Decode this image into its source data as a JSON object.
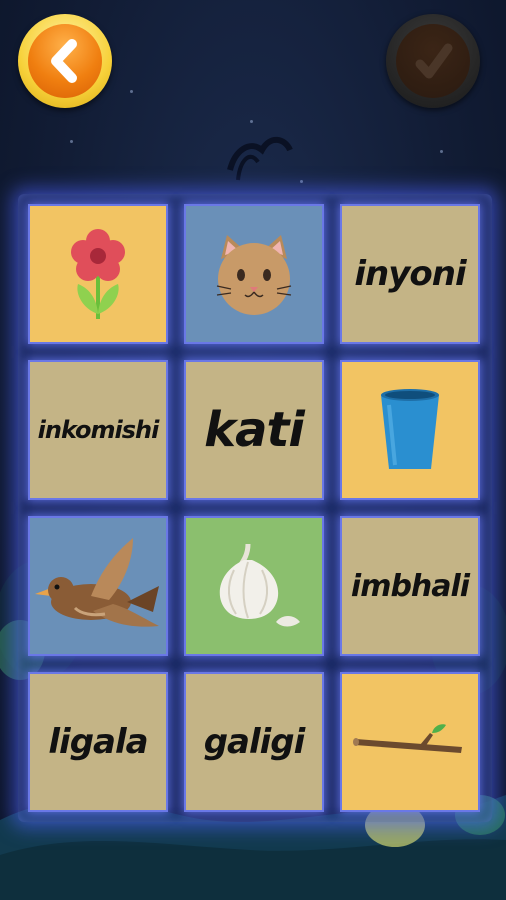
{
  "colors": {
    "tile_yellow": "#f2c463",
    "tile_khaki": "#c4b486",
    "tile_blue": "#6a90b8",
    "tile_green": "#8bbf6e",
    "glow_border": "#6a78e6"
  },
  "header": {
    "back_icon": "chevron-left-icon",
    "check_icon": "checkmark-icon"
  },
  "tiles": [
    {
      "kind": "image",
      "icon": "flower-icon",
      "bg": "#f2c463"
    },
    {
      "kind": "image",
      "icon": "cat-icon",
      "bg": "#6a90b8"
    },
    {
      "kind": "word",
      "text": "inyoni",
      "bg": "#c4b486"
    },
    {
      "kind": "word",
      "text": "inkomishi",
      "bg": "#c4b486"
    },
    {
      "kind": "word",
      "text": "kati",
      "bg": "#c4b486"
    },
    {
      "kind": "image",
      "icon": "cup-icon",
      "bg": "#f2c463"
    },
    {
      "kind": "image",
      "icon": "bird-icon",
      "bg": "#6a90b8"
    },
    {
      "kind": "image",
      "icon": "garlic-icon",
      "bg": "#8bbf6e"
    },
    {
      "kind": "word",
      "text": "imbhali",
      "bg": "#c4b486"
    },
    {
      "kind": "word",
      "text": "ligala",
      "bg": "#c4b486"
    },
    {
      "kind": "word",
      "text": "galigi",
      "bg": "#c4b486"
    },
    {
      "kind": "image",
      "icon": "stick-icon",
      "bg": "#f2c463"
    }
  ]
}
